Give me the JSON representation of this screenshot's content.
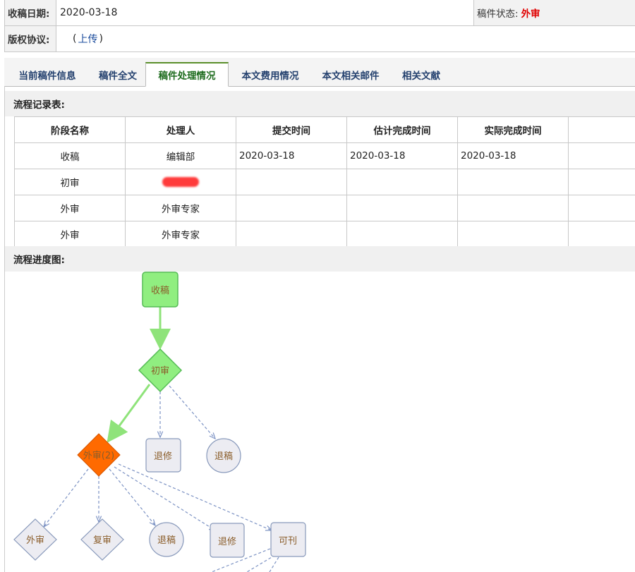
{
  "info": {
    "received_date_label": "收稿日期:",
    "received_date_value": "2020-03-18",
    "status_label": "稿件状态:",
    "status_value": "外审",
    "copyright_label": "版权协议:",
    "copyright_paren_open": "(",
    "copyright_link": "上传",
    "copyright_paren_close": ")"
  },
  "tabs": [
    {
      "label": "当前稿件信息",
      "active": false
    },
    {
      "label": "稿件全文",
      "active": false
    },
    {
      "label": "稿件处理情况",
      "active": true
    },
    {
      "label": "本文费用情况",
      "active": false
    },
    {
      "label": "本文相关邮件",
      "active": false
    },
    {
      "label": "相关文献",
      "active": false
    }
  ],
  "flow_record": {
    "title": "流程记录表:",
    "headers": [
      "阶段名称",
      "处理人",
      "提交时间",
      "估计完成时间",
      "实际完成时间",
      ""
    ],
    "rows": [
      [
        "收稿",
        "编辑部",
        "2020-03-18",
        "2020-03-18",
        "2020-03-18",
        ""
      ],
      [
        "初审",
        "",
        "",
        "",
        "",
        ""
      ],
      [
        "外审",
        "外审专家",
        "",
        "",
        "",
        ""
      ],
      [
        "外审",
        "外审专家",
        "",
        "",
        "",
        ""
      ]
    ]
  },
  "flow_chart": {
    "title": "流程进度图:",
    "nodes": {
      "received": "收稿",
      "initial_review": "初审",
      "external_review": "外审(2)",
      "return_revise_1": "退修",
      "reject_1": "退稿",
      "external_review_next": "外审",
      "re_review": "复审",
      "reject_2": "退稿",
      "return_revise_2": "退修",
      "acceptable": "可刊"
    },
    "colors": {
      "done_fill": "#90ee80",
      "done_stroke": "#55bb55",
      "current_fill": "#ff6a00",
      "pending_fill": "#ececf2",
      "pending_stroke": "#8899bb",
      "active_edge": "#8fe37a",
      "pending_edge": "#7d93c4",
      "label_color": "#8b5e2b"
    }
  }
}
